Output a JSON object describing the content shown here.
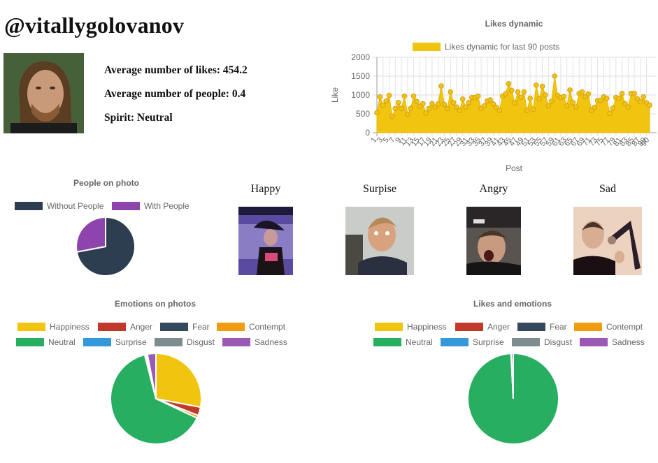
{
  "profile": {
    "username": "@vitallygolovanov",
    "avatar_icon": "profile-photo",
    "stats": [
      "Average number of likes: 454.2",
      "Average number of people: 0.4",
      "Spirit: Neutral"
    ]
  },
  "emotion_photos": [
    {
      "label": "Happy",
      "icon": "happy-photo"
    },
    {
      "label": "Surpise",
      "icon": "surprise-photo"
    },
    {
      "label": "Angry",
      "icon": "angry-photo"
    },
    {
      "label": "Sad",
      "icon": "sad-photo"
    }
  ],
  "colors": {
    "happiness": "#f1c40f",
    "anger": "#c0392b",
    "fear": "#34495e",
    "contempt": "#f39c12",
    "neutral": "#27ae60",
    "surprise": "#3498db",
    "disgust": "#7f8c8d",
    "sadness": "#9b59b6",
    "without_people": "#2c3e50",
    "with_people": "#8e44ad"
  },
  "chart_data": [
    {
      "id": "likes",
      "type": "area",
      "title": "Likes dynamic",
      "legend": [
        "Likes dynamic for last 90 posts"
      ],
      "legend_position": "top",
      "xlabel": "Post",
      "ylabel": "Like",
      "ylim": [
        0,
        2000
      ],
      "yticks": [
        0,
        500,
        1000,
        1500,
        2000
      ],
      "grid": true,
      "x": [
        1,
        2,
        3,
        4,
        5,
        6,
        7,
        8,
        9,
        10,
        11,
        12,
        13,
        14,
        15,
        16,
        17,
        18,
        19,
        20,
        21,
        22,
        23,
        24,
        25,
        26,
        27,
        28,
        29,
        30,
        31,
        32,
        33,
        34,
        35,
        36,
        37,
        38,
        39,
        40,
        41,
        42,
        43,
        44,
        45,
        46,
        47,
        48,
        49,
        50,
        51,
        52,
        53,
        54,
        55,
        56,
        57,
        58,
        59,
        60,
        61,
        62,
        63,
        64,
        65,
        66,
        67,
        68,
        69,
        70,
        71,
        72,
        73,
        74,
        75,
        76,
        77,
        78,
        79,
        80,
        81,
        82,
        83,
        84,
        85,
        86,
        87,
        88,
        89,
        90
      ],
      "xtick_labels": [
        "1",
        "3",
        "5",
        "7",
        "9",
        "11",
        "13",
        "15",
        "17",
        "19",
        "21",
        "23",
        "25",
        "27",
        "29",
        "31",
        "33",
        "35",
        "37",
        "39",
        "41",
        "43",
        "45",
        "47",
        "49",
        "51",
        "53",
        "55",
        "57",
        "59",
        "61",
        "63",
        "65",
        "67",
        "69",
        "71",
        "73",
        "75",
        "77",
        "79",
        "81",
        "83",
        "85",
        "87",
        "89",
        "90"
      ],
      "series": [
        {
          "name": "Likes dynamic for last 90 posts",
          "color": "#f1c40f",
          "values": [
            530,
            950,
            730,
            840,
            990,
            430,
            640,
            800,
            640,
            970,
            490,
            640,
            970,
            830,
            700,
            770,
            520,
            640,
            770,
            680,
            760,
            1240,
            750,
            640,
            1080,
            800,
            680,
            590,
            890,
            680,
            800,
            930,
            930,
            970,
            640,
            710,
            840,
            870,
            760,
            670,
            590,
            970,
            1030,
            1300,
            1120,
            790,
            1080,
            940,
            1080,
            590,
            910,
            620,
            1260,
            900,
            1230,
            1000,
            710,
            840,
            1500,
            990,
            930,
            960,
            710,
            1130,
            800,
            680,
            1040,
            1080,
            950,
            1030,
            590,
            670,
            850,
            860,
            950,
            910,
            510,
            650,
            930,
            910,
            1040,
            770,
            680,
            1040,
            1040,
            900,
            820,
            950,
            790,
            730
          ]
        }
      ]
    },
    {
      "id": "people",
      "type": "pie",
      "title": "People on photo",
      "legend_position": "top",
      "categories": [
        "Without People",
        "With People"
      ],
      "values": [
        72,
        28
      ],
      "colors": [
        "#2c3e50",
        "#8e44ad"
      ]
    },
    {
      "id": "emotions",
      "type": "pie",
      "title": "Emotions on photos",
      "legend_position": "top",
      "categories": [
        "Happiness",
        "Anger",
        "Fear",
        "Contempt",
        "Neutral",
        "Surprise",
        "Disgust",
        "Sadness"
      ],
      "values": [
        28,
        3,
        0,
        1,
        64,
        0.5,
        0.5,
        3
      ],
      "colors": [
        "#f1c40f",
        "#c0392b",
        "#34495e",
        "#f39c12",
        "#27ae60",
        "#3498db",
        "#7f8c8d",
        "#9b59b6"
      ]
    },
    {
      "id": "likes_emotions",
      "type": "pie",
      "title": "Likes and emotions",
      "legend_position": "top",
      "categories": [
        "Happiness",
        "Anger",
        "Fear",
        "Contempt",
        "Neutral",
        "Surprise",
        "Disgust",
        "Sadness"
      ],
      "values": [
        0,
        0,
        0,
        0,
        99.2,
        0,
        0.1,
        0.7
      ],
      "colors": [
        "#f1c40f",
        "#c0392b",
        "#34495e",
        "#f39c12",
        "#27ae60",
        "#3498db",
        "#7f8c8d",
        "#9b59b6"
      ]
    }
  ]
}
